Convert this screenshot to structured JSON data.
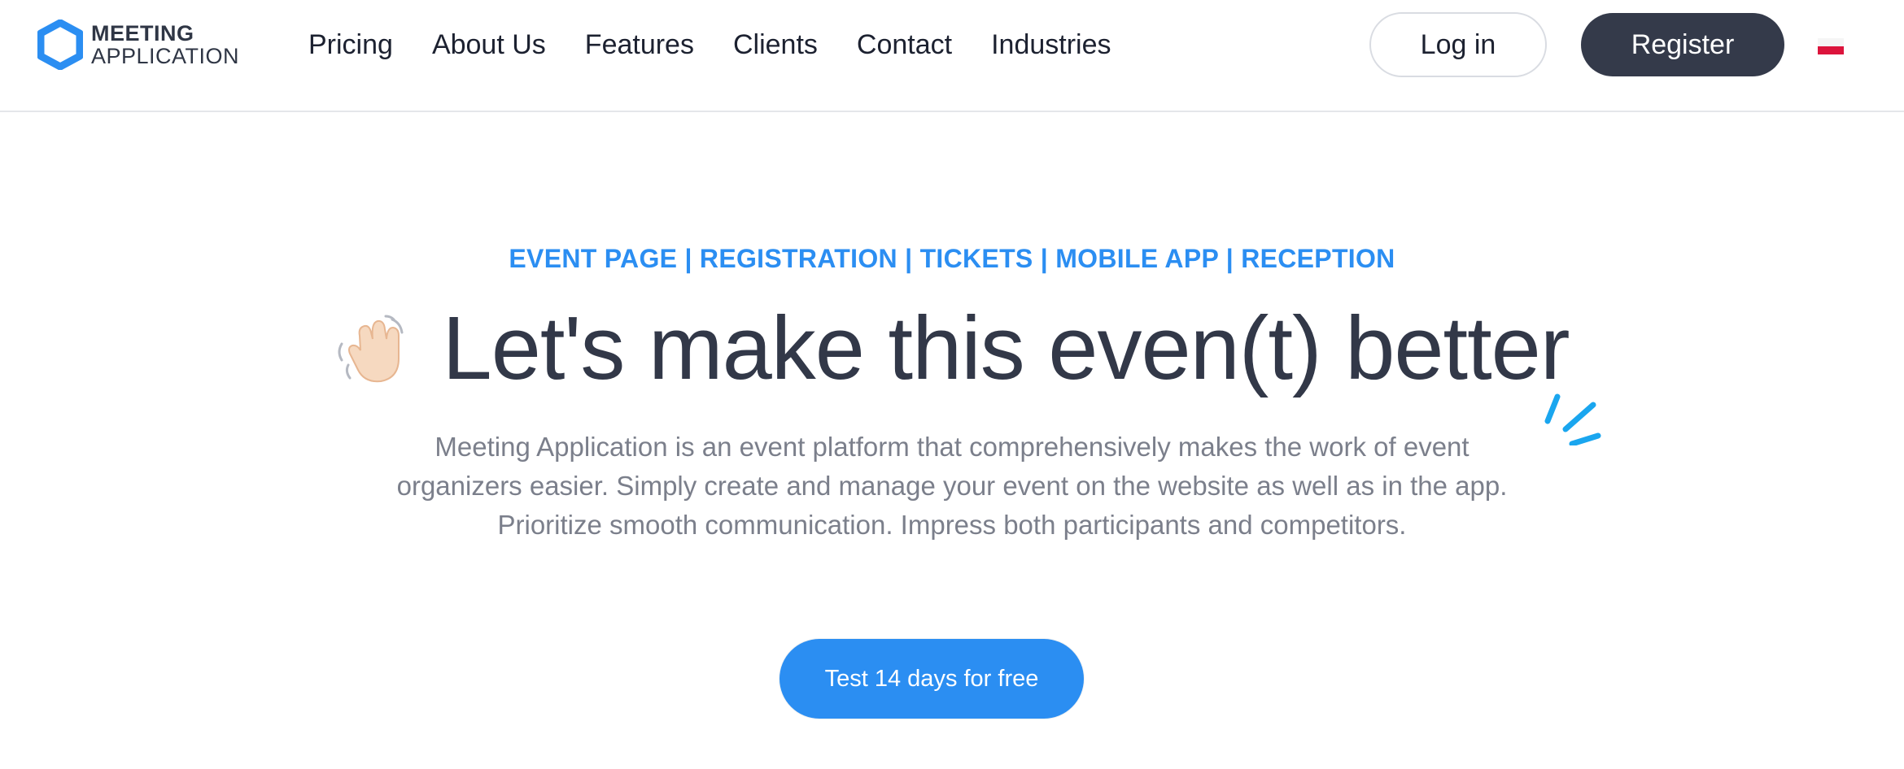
{
  "logo": {
    "line1": "MEETING",
    "line2": "APPLICATION",
    "icon": "hexagon-logo-icon",
    "color": "#2b8ef2"
  },
  "nav": {
    "items": [
      {
        "label": "Pricing"
      },
      {
        "label": "About Us"
      },
      {
        "label": "Features"
      },
      {
        "label": "Clients"
      },
      {
        "label": "Contact"
      },
      {
        "label": "Industries"
      }
    ]
  },
  "header": {
    "login_label": "Log in",
    "register_label": "Register",
    "language_flag": "poland-flag-icon"
  },
  "hero": {
    "tagline": "EVENT PAGE | REGISTRATION | TICKETS | MOBILE APP | RECEPTION",
    "headline": "Let's make this even(t) better",
    "headline_icon": "waving-hand-icon",
    "accent_icon": "sparkle-lines-icon",
    "description": "Meeting Application is an event platform that comprehensively makes the work of event organizers easier. Simply create and manage your event on the website as well as in the app. Prioritize smooth communication. Impress both participants and competitors.",
    "cta_label": "Test 14 days for free"
  },
  "colors": {
    "accent": "#2b8ef2",
    "dark": "#343a4a",
    "headline_text": "#323848",
    "body_text": "#7b7f8b"
  }
}
